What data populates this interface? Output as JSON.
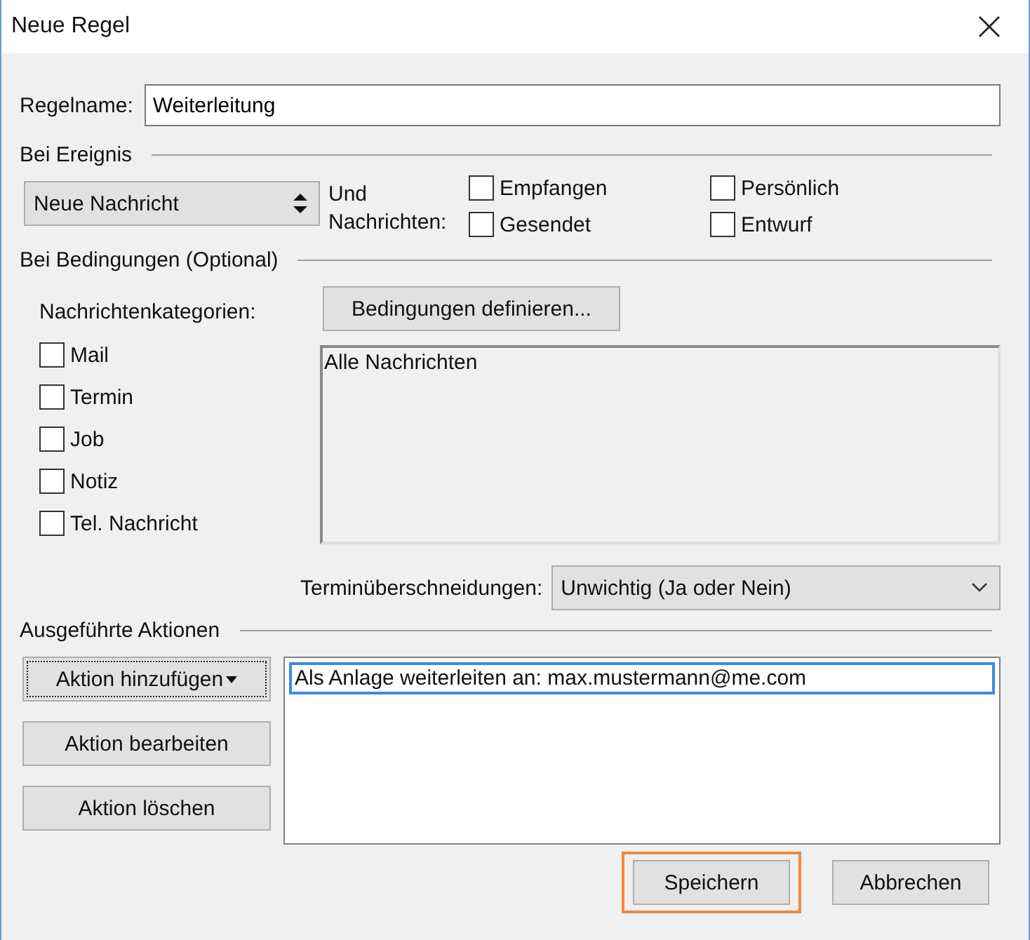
{
  "window": {
    "title": "Neue Regel"
  },
  "rule_name": {
    "label": "Regelname:",
    "value": "Weiterleitung"
  },
  "event": {
    "heading": "Bei Ereignis",
    "select": "Neue Nachricht",
    "and_label": "Und Nachrichten:",
    "options": [
      {
        "label": "Empfangen",
        "checked": false
      },
      {
        "label": "Persönlich",
        "checked": false
      },
      {
        "label": "Gesendet",
        "checked": false
      },
      {
        "label": "Entwurf",
        "checked": false
      }
    ]
  },
  "conditions": {
    "heading": "Bei Bedingungen  (Optional)",
    "categories_label": "Nachrichtenkategorien:",
    "define_button": "Bedingungen definieren...",
    "categories": [
      {
        "label": "Mail",
        "checked": false
      },
      {
        "label": "Termin",
        "checked": false
      },
      {
        "label": "Job",
        "checked": false
      },
      {
        "label": "Notiz",
        "checked": false
      },
      {
        "label": "Tel. Nachricht",
        "checked": false
      }
    ],
    "summary": "Alle Nachrichten",
    "overlap_label": "Terminüberschneidungen:",
    "overlap_value": "Unwichtig (Ja oder Nein)"
  },
  "actions": {
    "heading": "Ausgeführte Aktionen",
    "buttons": [
      {
        "label": "Aktion hinzufügen",
        "kind": "menu",
        "focused": true
      },
      {
        "label": "Aktion bearbeiten",
        "kind": "plain",
        "focused": false
      },
      {
        "label": "Aktion löschen",
        "kind": "plain",
        "focused": false
      }
    ],
    "items": [
      {
        "text": "Als Anlage weiterleiten an: max.mustermann@me.com",
        "selected": true
      }
    ]
  },
  "footer": [
    {
      "label": "Speichern",
      "focused": true
    },
    {
      "label": "Abbrechen",
      "focused": false
    }
  ]
}
